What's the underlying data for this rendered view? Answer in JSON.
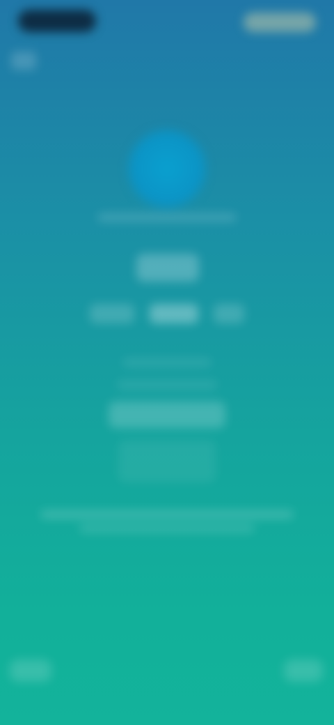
{
  "theme": {
    "gradient_top": "#2078a8",
    "gradient_bottom": "#13b39b",
    "logo_color": "#0aa0cf"
  },
  "status_bar": {
    "left_pill": "",
    "right_pill": ""
  },
  "header": {
    "back_label": ""
  },
  "hero": {
    "title": "",
    "value": ""
  },
  "tabs": [
    {
      "label": ""
    },
    {
      "label": ""
    },
    {
      "label": ""
    }
  ],
  "main": {
    "cta_label": ""
  },
  "banner": {
    "line1": "",
    "line2": ""
  },
  "footer": {
    "left_label": "",
    "right_label": ""
  }
}
